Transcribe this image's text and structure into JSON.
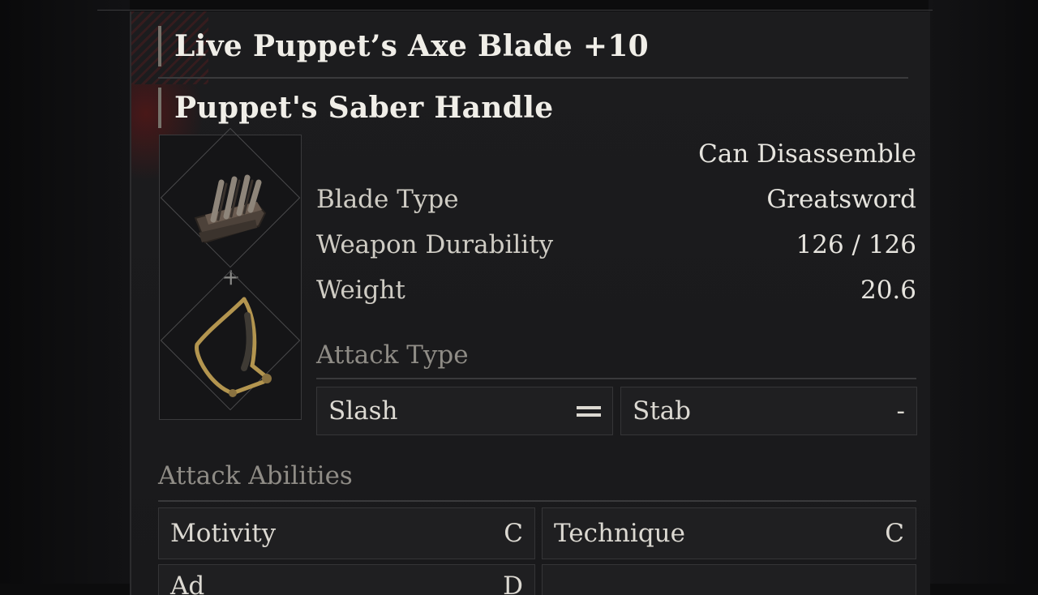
{
  "title": "Live Puppet’s Axe Blade +10",
  "handle_name": "Puppet's Saber Handle",
  "disassemble": "Can Disassemble",
  "stats": [
    {
      "label": "Blade Type",
      "value": "Greatsword"
    },
    {
      "label": "Weapon Durability",
      "value": "126 / 126"
    },
    {
      "label": "Weight",
      "value": "20.6"
    }
  ],
  "attack_type": {
    "heading": "Attack Type",
    "slash": {
      "label": "Slash",
      "icon": "equal-icon"
    },
    "stab": {
      "label": "Stab",
      "value": "-"
    }
  },
  "attack_abilities": {
    "heading": "Attack Abilities",
    "items": [
      {
        "label": "Motivity",
        "value": "C"
      },
      {
        "label": "Technique",
        "value": "C"
      },
      {
        "label": "Ad",
        "value": "D"
      }
    ]
  },
  "icons": {
    "blade": "axe-blade-icon",
    "handle": "saber-handle-icon",
    "combine": "plus-icon"
  },
  "colors": {
    "background": "#0c0c0d",
    "panel": "#1c1c1e",
    "text": "#e2e0da",
    "muted_text": "#8f8c86",
    "accent_red": "#6e1414"
  }
}
